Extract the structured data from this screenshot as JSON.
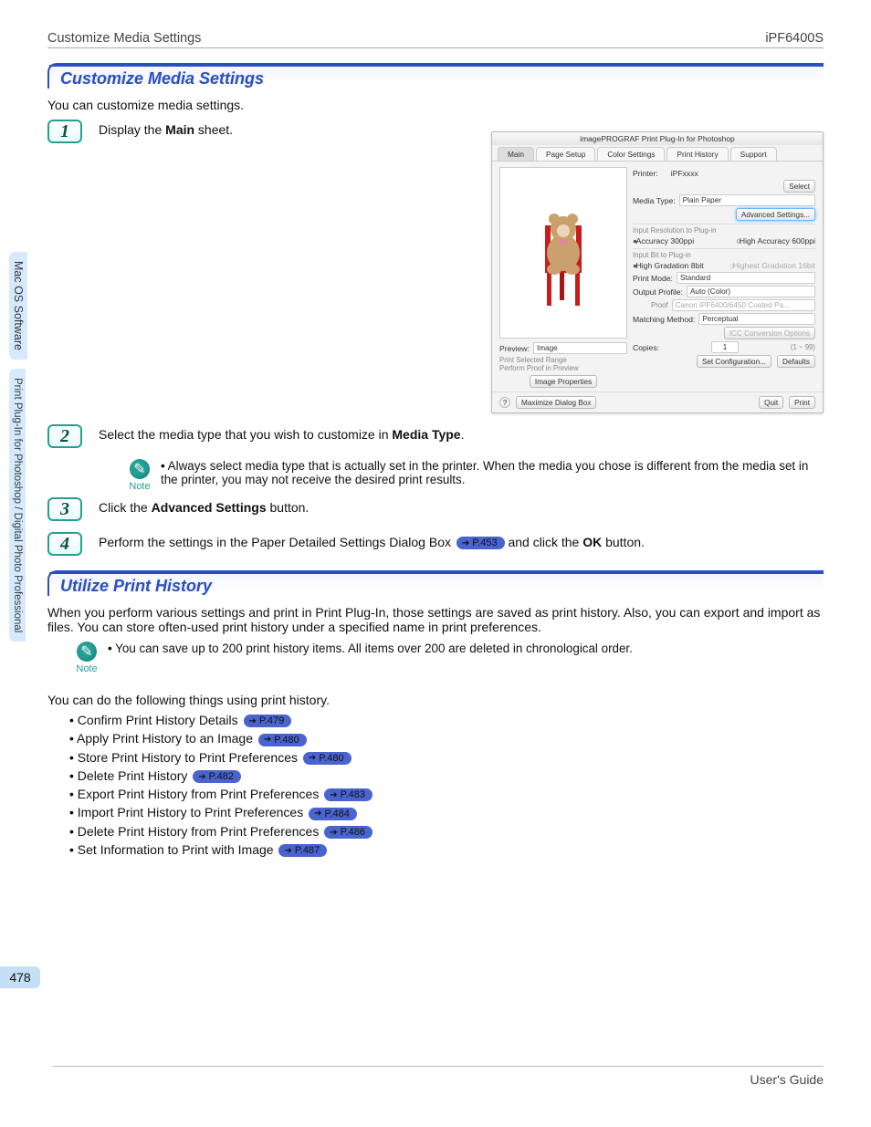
{
  "header": {
    "left": "Customize Media Settings",
    "right": "iPF6400S"
  },
  "sidebar": {
    "main": "Mac OS Software",
    "sub": "Print Plug-In for Photoshop / Digital Photo Professional"
  },
  "section1": {
    "title": "Customize Media Settings",
    "intro": "You can customize media settings."
  },
  "steps": {
    "s1": {
      "num": "1",
      "prefix": "Display the ",
      "bold": "Main",
      "suffix": " sheet."
    },
    "s2": {
      "num": "2",
      "prefix": "Select the media type that you wish to customize in ",
      "bold": "Media Type",
      "suffix": "."
    },
    "s3": {
      "num": "3",
      "prefix": "Click the ",
      "bold": "Advanced Settings",
      "suffix": " button."
    },
    "s4": {
      "num": "4",
      "prefix": "Perform the settings in the Paper Detailed Settings Dialog Box ",
      "ref": "P.453",
      "mid": "  and click the ",
      "bold": "OK",
      "suffix": " button."
    }
  },
  "note1": {
    "label": "Note",
    "text": "Always select media type that is actually set in the printer. When the media you chose is different from the media set in the printer, you may not receive the desired print results."
  },
  "dialog": {
    "title": "imagePROGRAF Print Plug-In for Photoshop",
    "tabs": [
      "Main",
      "Page Setup",
      "Color Settings",
      "Print History",
      "Support"
    ],
    "printer_lbl": "Printer:",
    "printer_val": "iPFxxxx",
    "select_btn": "Select",
    "media_lbl": "Media Type:",
    "media_val": "Plain Paper",
    "adv_btn": "Advanced Settings...",
    "res_lbl": "Input Resolution to Plug-in",
    "res1": "Accuracy 300ppi",
    "res2": "High Accuracy 600ppi",
    "bit_lbl": "Input Bit to Plug-in",
    "bit1": "High Gradation 8bit",
    "bit2": "Highest Gradation 16bit",
    "mode_lbl": "Print Mode:",
    "mode_val": "Standard",
    "out_lbl": "Output Profile:",
    "out_val": "Auto (Color)",
    "proof_lbl": "Proof",
    "proof_val": "Canon iPF6400/6450 Coated Pa...",
    "match_lbl": "Matching Method:",
    "match_val": "Perceptual",
    "icc_btn": "ICC Conversion Options",
    "copies_lbl": "Copies:",
    "copies_val": "1",
    "copies_range": "(1 ~ 99)",
    "setconf_btn": "Set Configuration...",
    "defaults_btn": "Defaults",
    "preview_lbl": "Preview:",
    "preview_val": "Image",
    "chk1": "Print Selected Range",
    "chk2": "Perform Proof in Preview",
    "imgprop_btn": "Image Properties",
    "help": "?",
    "max_btn": "Maximize Dialog Box",
    "quit_btn": "Quit",
    "print_btn": "Print"
  },
  "section2": {
    "title": "Utilize Print History",
    "intro": "When you perform various settings and print in Print Plug-In, those settings are saved as print history. Also, you can export and import as files. You can store often-used print history under a specified name in print preferences."
  },
  "note2": {
    "label": "Note",
    "text": "You can save up to 200 print history items. All items over 200 are deleted in chronological order."
  },
  "listhdr": "You can do the following things using print history.",
  "things": [
    {
      "t": "Confirm Print History Details",
      "p": "P.479"
    },
    {
      "t": "Apply Print History to an Image",
      "p": "P.480"
    },
    {
      "t": "Store Print History to Print Preferences",
      "p": "P.480"
    },
    {
      "t": "Delete Print History",
      "p": "P.482"
    },
    {
      "t": "Export Print History from Print Preferences",
      "p": "P.483"
    },
    {
      "t": "Import Print History to Print Preferences",
      "p": "P.484"
    },
    {
      "t": "Delete Print History from Print Preferences",
      "p": "P.486"
    },
    {
      "t": "Set Information to Print with Image",
      "p": "P.487"
    }
  ],
  "footer": {
    "pagenum": "478",
    "guide": "User's Guide"
  }
}
